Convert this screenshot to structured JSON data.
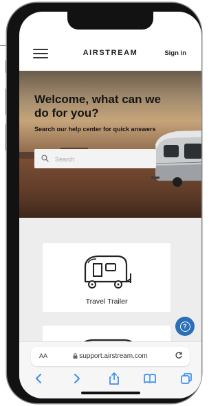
{
  "header": {
    "logo": "AIRSTREAM",
    "sign_in": "Sign in"
  },
  "hero": {
    "title": "Welcome, what can we do for you?",
    "subtitle": "Search our help center for quick answers",
    "search_placeholder": "Search"
  },
  "cards": [
    {
      "label": "Travel Trailer",
      "icon": "travel-trailer-icon"
    },
    {
      "label": "",
      "icon": "touring-coach-icon"
    }
  ],
  "browser": {
    "text_size_label": "AA",
    "url": "support.airstream.com",
    "lock_icon": "lock-icon",
    "reload_icon": "reload-icon",
    "toolbar_icons": [
      "back-icon",
      "forward-icon",
      "share-icon",
      "bookmarks-icon",
      "tabs-icon"
    ]
  },
  "colors": {
    "accent_blue": "#2a6fb8",
    "safari_blue": "#3a8ef0",
    "content_bg": "#ededed"
  }
}
